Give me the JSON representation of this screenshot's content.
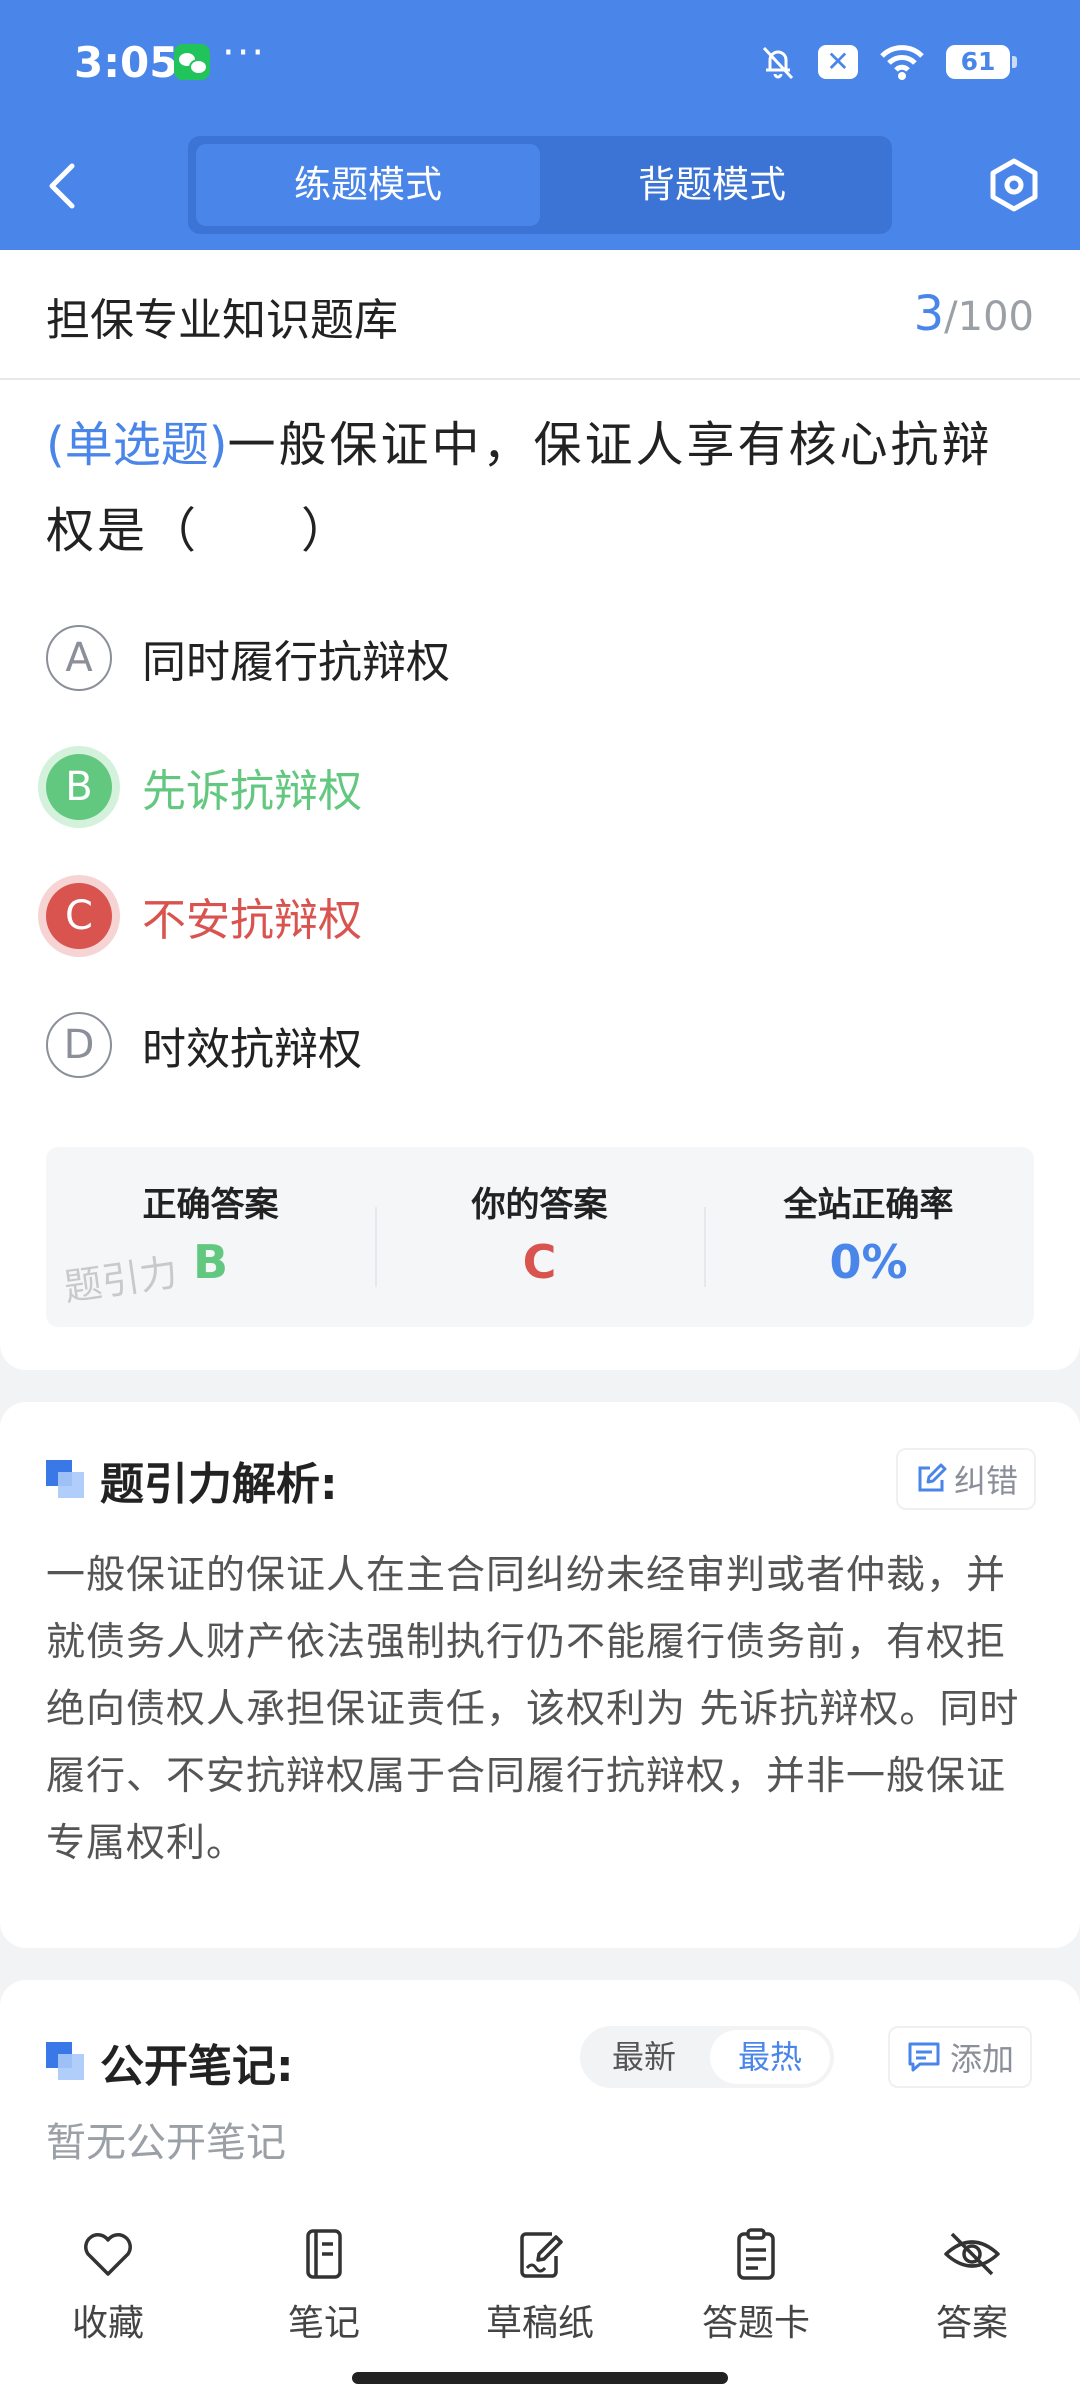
{
  "status_bar": {
    "time": "3:05",
    "more": "···",
    "battery": "61",
    "mute_x": "✕"
  },
  "header": {
    "modes": [
      {
        "label": "练题模式",
        "active": true
      },
      {
        "label": "背题模式",
        "active": false
      }
    ]
  },
  "question_bank": {
    "title": "担保专业知识题库",
    "current": "3",
    "total": "/100"
  },
  "question": {
    "type": "(单选题)",
    "text": "一般保证中，保证人享有核心抗辩权是（　　）",
    "options": [
      {
        "key": "A",
        "text": "同时履行抗辩权",
        "state": "normal"
      },
      {
        "key": "B",
        "text": "先诉抗辩权",
        "state": "correct"
      },
      {
        "key": "C",
        "text": "不安抗辩权",
        "state": "wrong"
      },
      {
        "key": "D",
        "text": "时效抗辩权",
        "state": "normal"
      }
    ]
  },
  "result": {
    "correct_label": "正确答案",
    "correct_value": "B",
    "yours_label": "你的答案",
    "yours_value": "C",
    "rate_label": "全站正确率",
    "rate_value": "0%",
    "watermark": "题引力"
  },
  "analysis": {
    "title": "题引力解析:",
    "report_label": "纠错",
    "text": "一般保证的保证人在主合同纠纷未经审判或者仲裁，并就债务人财产依法强制执行仍不能履行债务前，有权拒绝向债权人承担保证责任，该权利为 先诉抗辩权。同时履行、不安抗辩权属于合同履行抗辩权，并非一般保证专属权利。"
  },
  "notes": {
    "title": "公开笔记:",
    "sort_latest": "最新",
    "sort_hot": "最热",
    "add_label": "添加",
    "empty": "暂无公开笔记"
  },
  "bottom_tabs": [
    {
      "label": "收藏",
      "icon": "heart-icon"
    },
    {
      "label": "笔记",
      "icon": "notebook-icon"
    },
    {
      "label": "草稿纸",
      "icon": "draft-icon"
    },
    {
      "label": "答题卡",
      "icon": "answer-card-icon"
    },
    {
      "label": "答案",
      "icon": "eye-off-icon"
    }
  ],
  "colors": {
    "primary": "#4a86ea",
    "correct": "#63c87f",
    "wrong": "#d9534f"
  }
}
